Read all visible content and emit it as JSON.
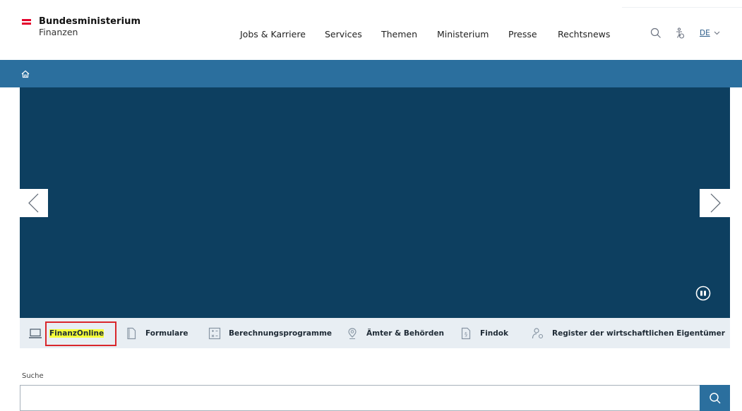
{
  "header": {
    "logo": {
      "line1": "Bundesministerium",
      "line2": "Finanzen",
      "flag_colors": [
        "#e4002b",
        "#ffffff",
        "#e4002b"
      ]
    },
    "nav": [
      {
        "label": "Jobs & Karriere"
      },
      {
        "label": "Services"
      },
      {
        "label": "Themen"
      },
      {
        "label": "Ministerium"
      },
      {
        "label": "Presse"
      },
      {
        "label": "Rechtsnews"
      }
    ],
    "icons": {
      "search": "search-icon",
      "accessibility": "accessibility-icon"
    },
    "language": "DE"
  },
  "breadcrumb": {
    "icon": "home-icon"
  },
  "hero": {
    "prev_icon": "chevron-left-icon",
    "next_icon": "chevron-right-icon",
    "pause_icon": "pause-icon"
  },
  "quicklinks": [
    {
      "label": "FinanzOnline",
      "icon": "laptop-icon"
    },
    {
      "label": "Formulare",
      "icon": "document-icon"
    },
    {
      "label": "Berechnungsprogramme",
      "icon": "calculator-icon"
    },
    {
      "label": "Ämter & Behörden",
      "icon": "location-pin-icon"
    },
    {
      "label": "Findok",
      "icon": "document-paragraph-icon"
    },
    {
      "label": "Register der wirtschaftlichen Eigentümer",
      "icon": "person-key-icon"
    }
  ],
  "search": {
    "label": "Suche",
    "value": "",
    "button_icon": "search-icon"
  },
  "colors": {
    "primary": "#2b6f9e",
    "hero": "#0d3f60",
    "quickbar": "#e8eef3",
    "highlight": "#f6ff3a",
    "annotation": "#d9262b"
  }
}
